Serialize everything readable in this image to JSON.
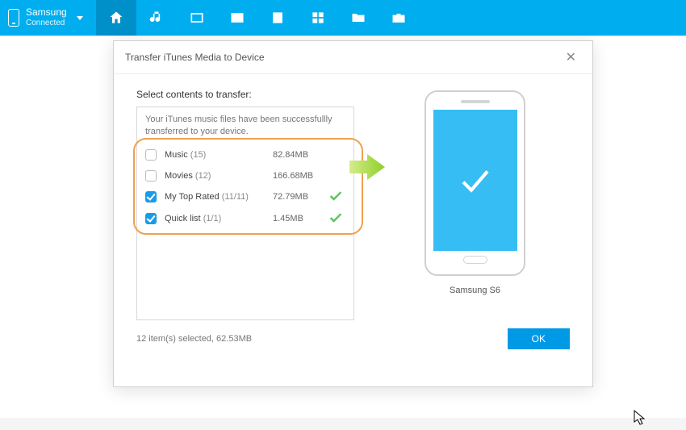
{
  "device": {
    "name": "Samsung",
    "status": "Connected"
  },
  "modal": {
    "title": "Transfer iTunes Media to Device",
    "prompt": "Select contents to transfer:",
    "message": "Your iTunes music files have been successfullly transferred to your device.",
    "items": [
      {
        "label": "Music",
        "count": "(15)",
        "size": "82.84MB",
        "checked": false,
        "done": false
      },
      {
        "label": "Movies",
        "count": "(12)",
        "size": "166.68MB",
        "checked": false,
        "done": false
      },
      {
        "label": "My Top Rated",
        "count": "(11/11)",
        "size": "72.79MB",
        "checked": true,
        "done": true
      },
      {
        "label": "Quick list",
        "count": "(1/1)",
        "size": "1.45MB",
        "checked": true,
        "done": true
      }
    ],
    "target_label": "Samsung S6",
    "footer_status": "12 item(s) selected, 62.53MB",
    "ok_label": "OK"
  }
}
